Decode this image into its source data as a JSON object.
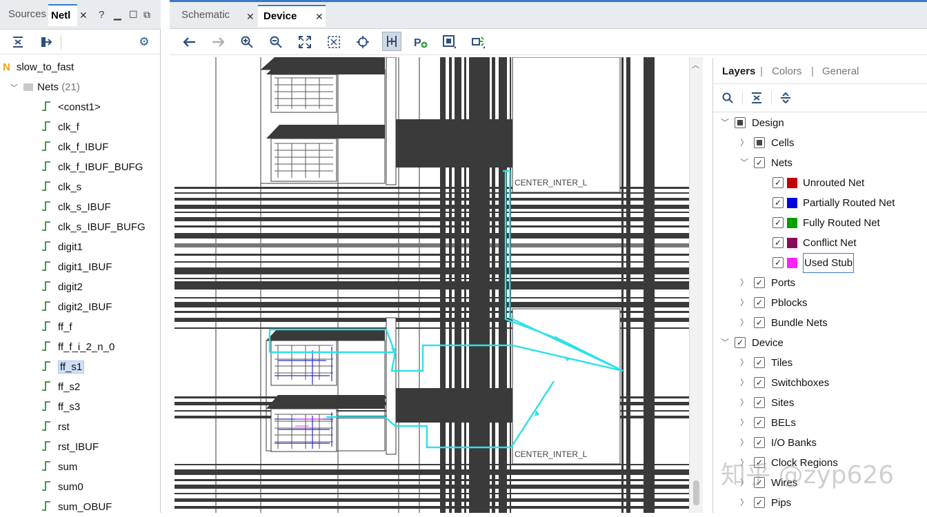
{
  "left_panel": {
    "tabs": [
      {
        "label": "Sources"
      },
      {
        "label": "Netl"
      }
    ],
    "root_label": "slow_to_fast",
    "nets_folder": {
      "label": "Nets",
      "count": "(21)"
    },
    "nets": [
      "<const1>",
      "clk_f",
      "clk_f_IBUF",
      "clk_f_IBUF_BUFG",
      "clk_s",
      "clk_s_IBUF",
      "clk_s_IBUF_BUFG",
      "digit1",
      "digit1_IBUF",
      "digit2",
      "digit2_IBUF",
      "ff_f",
      "ff_f_i_2_n_0",
      "ff_s1",
      "ff_s2",
      "ff_s3",
      "rst",
      "rst_IBUF",
      "sum",
      "sum0",
      "sum_OBUF"
    ],
    "selected_net": "ff_s1"
  },
  "right_panel": {
    "tabs": [
      {
        "label": "Schematic"
      },
      {
        "label": "Device"
      }
    ],
    "active_tab": "Device",
    "tile_labels": [
      "CENTER_INTER_L",
      "CENTER_INTER_L"
    ]
  },
  "layers_panel": {
    "tabs": [
      {
        "label": "Layers"
      },
      {
        "label": "Colors"
      },
      {
        "label": "General"
      }
    ],
    "separator": "|",
    "design": {
      "label": "Design"
    },
    "cells": {
      "label": "Cells"
    },
    "nets": {
      "label": "Nets"
    },
    "net_types": [
      {
        "label": "Unrouted Net",
        "color": "#c40000"
      },
      {
        "label": "Partially Routed Net",
        "color": "#0000e0"
      },
      {
        "label": "Fully Routed Net",
        "color": "#00a000"
      },
      {
        "label": "Conflict Net",
        "color": "#8a0a5a"
      },
      {
        "label": "Used Stub",
        "color": "#ff20ff"
      }
    ],
    "design_items": [
      {
        "label": "Ports"
      },
      {
        "label": "Pblocks"
      },
      {
        "label": "Bundle Nets"
      }
    ],
    "device": {
      "label": "Device"
    },
    "device_items": [
      {
        "label": "Tiles"
      },
      {
        "label": "Switchboxes"
      },
      {
        "label": "Sites"
      },
      {
        "label": "BELs"
      },
      {
        "label": "I/O Banks"
      },
      {
        "label": "Clock Regions"
      },
      {
        "label": "Wires"
      },
      {
        "label": "Pips"
      }
    ]
  },
  "watermark": "知乎 @zyp626",
  "colors": {
    "accent": "#3a79c4",
    "route": "#2ee0ea",
    "fabric": "#3a3a3a"
  }
}
